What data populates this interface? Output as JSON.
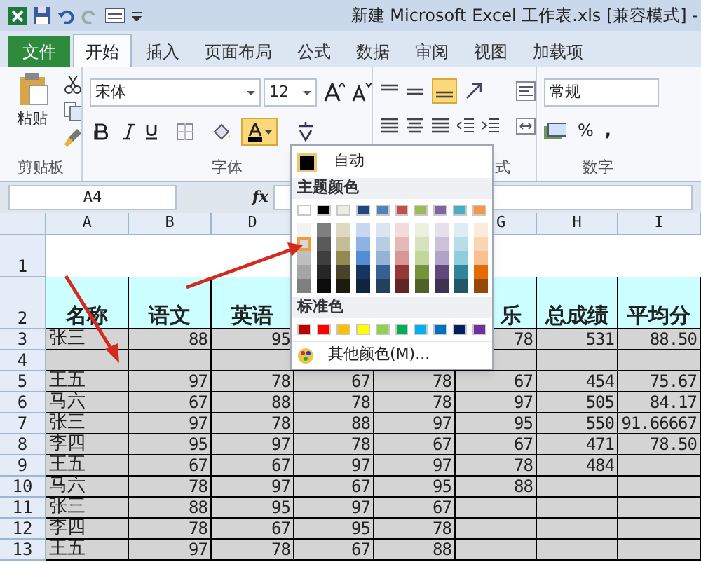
{
  "window": {
    "title": "新建 Microsoft Excel 工作表.xls  [兼容模式]  -"
  },
  "tabs": [
    {
      "label": "文件",
      "kind": "file",
      "selected": false
    },
    {
      "label": "开始",
      "kind": "tab",
      "selected": true
    },
    {
      "label": "插入",
      "kind": "tab",
      "selected": false
    },
    {
      "label": "页面布局",
      "kind": "tab",
      "selected": false
    },
    {
      "label": "公式",
      "kind": "tab",
      "selected": false
    },
    {
      "label": "数据",
      "kind": "tab",
      "selected": false
    },
    {
      "label": "审阅",
      "kind": "tab",
      "selected": false
    },
    {
      "label": "视图",
      "kind": "tab",
      "selected": false
    },
    {
      "label": "加载项",
      "kind": "tab",
      "selected": false
    }
  ],
  "ribbon": {
    "clipboard": {
      "paste_label": "粘贴",
      "group_label": "剪贴板"
    },
    "font": {
      "font_name": "宋体",
      "font_size": "12",
      "group_label": "字体",
      "font_color_open": true
    },
    "alignment": {
      "group_label": "式"
    },
    "number": {
      "format": "常规",
      "percent": "%",
      "comma": ",",
      "group_label": "数字"
    }
  },
  "formula_bar": {
    "name_box": "A4",
    "fx": "fx"
  },
  "color_menu": {
    "auto_label": "自动",
    "theme_label": "主题颜色",
    "theme_top": [
      {
        "color": "#ffffff"
      },
      {
        "color": "#000000"
      },
      {
        "color": "#eeece1"
      },
      {
        "color": "#1f497d"
      },
      {
        "color": "#4f81bd"
      },
      {
        "color": "#c0504d"
      },
      {
        "color": "#9bbb59"
      },
      {
        "color": "#8064a2"
      },
      {
        "color": "#4bacc6"
      },
      {
        "color": "#f79646"
      }
    ],
    "theme_shades": [
      [
        {
          "color": "#f2f2f2",
          "selected": false
        },
        {
          "color": "#7f7f7f",
          "selected": false
        },
        {
          "color": "#ddd9c3",
          "selected": false
        },
        {
          "color": "#c6d9f0",
          "selected": false
        },
        {
          "color": "#dbe5f1",
          "selected": false
        },
        {
          "color": "#f2dcdb",
          "selected": false
        },
        {
          "color": "#ebf1dd",
          "selected": false
        },
        {
          "color": "#e5e0ec",
          "selected": false
        },
        {
          "color": "#dbeef3",
          "selected": false
        },
        {
          "color": "#fdeada",
          "selected": false
        }
      ],
      [
        {
          "color": "#d8d8d8",
          "selected": true
        },
        {
          "color": "#595959",
          "selected": false
        },
        {
          "color": "#c4bd97",
          "selected": false
        },
        {
          "color": "#8db3e2",
          "selected": false
        },
        {
          "color": "#b8cce4",
          "selected": false
        },
        {
          "color": "#e5b9b7",
          "selected": false
        },
        {
          "color": "#d7e3bc",
          "selected": false
        },
        {
          "color": "#ccc1d9",
          "selected": false
        },
        {
          "color": "#b7dde8",
          "selected": false
        },
        {
          "color": "#fbd5b5",
          "selected": false
        }
      ],
      [
        {
          "color": "#bfbfbf",
          "selected": false
        },
        {
          "color": "#3f3f3f",
          "selected": false
        },
        {
          "color": "#938953",
          "selected": false
        },
        {
          "color": "#548dd4",
          "selected": false
        },
        {
          "color": "#95b3d7",
          "selected": false
        },
        {
          "color": "#d99694",
          "selected": false
        },
        {
          "color": "#c3d69b",
          "selected": false
        },
        {
          "color": "#b2a2c7",
          "selected": false
        },
        {
          "color": "#92cddc",
          "selected": false
        },
        {
          "color": "#fac08f",
          "selected": false
        }
      ],
      [
        {
          "color": "#a5a5a5",
          "selected": false
        },
        {
          "color": "#262626",
          "selected": false
        },
        {
          "color": "#494429",
          "selected": false
        },
        {
          "color": "#17365d",
          "selected": false
        },
        {
          "color": "#366092",
          "selected": false
        },
        {
          "color": "#953734",
          "selected": false
        },
        {
          "color": "#76923c",
          "selected": false
        },
        {
          "color": "#5f497a",
          "selected": false
        },
        {
          "color": "#31859b",
          "selected": false
        },
        {
          "color": "#e36c09",
          "selected": false
        }
      ],
      [
        {
          "color": "#7f7f7f",
          "selected": false
        },
        {
          "color": "#0c0c0c",
          "selected": false
        },
        {
          "color": "#1d1b10",
          "selected": false
        },
        {
          "color": "#0f243e",
          "selected": false
        },
        {
          "color": "#244061",
          "selected": false
        },
        {
          "color": "#632423",
          "selected": false
        },
        {
          "color": "#4f6128",
          "selected": false
        },
        {
          "color": "#3f3151",
          "selected": false
        },
        {
          "color": "#205867",
          "selected": false
        },
        {
          "color": "#974806",
          "selected": false
        }
      ]
    ],
    "standard_label": "标准色",
    "standard": [
      {
        "color": "#c00000"
      },
      {
        "color": "#ff0000"
      },
      {
        "color": "#ffc000"
      },
      {
        "color": "#ffff00"
      },
      {
        "color": "#92d050"
      },
      {
        "color": "#00b050"
      },
      {
        "color": "#00b0f0"
      },
      {
        "color": "#0070c0"
      },
      {
        "color": "#002060"
      },
      {
        "color": "#7030a0"
      }
    ],
    "more_label": "其他颜色(M)..."
  },
  "sheet": {
    "columns": [
      "A",
      "B",
      "D",
      null,
      null,
      "G",
      "H",
      "I"
    ],
    "rows": [
      {
        "number": "1",
        "kind": "blank",
        "cells": []
      },
      {
        "number": "2",
        "kind": "header",
        "cells": [
          "名称",
          "语文",
          "英语",
          null,
          null,
          "乐",
          "总成绩",
          "平均分"
        ]
      },
      {
        "number": "3",
        "kind": "data",
        "cells": [
          "张三",
          "88",
          "95",
          null,
          null,
          "78",
          "531",
          "88.50"
        ]
      },
      {
        "number": "4",
        "kind": "data",
        "cells": []
      },
      {
        "number": "5",
        "kind": "data",
        "cells": [
          "王五",
          "97",
          "78",
          "67",
          "78",
          "67",
          "454",
          "75.67"
        ]
      },
      {
        "number": "6",
        "kind": "data",
        "cells": [
          "马六",
          "67",
          "88",
          "78",
          "78",
          "97",
          "505",
          "84.17"
        ]
      },
      {
        "number": "7",
        "kind": "data",
        "cells": [
          "张三",
          "97",
          "78",
          "88",
          "97",
          "95",
          "550",
          "91.66667"
        ]
      },
      {
        "number": "8",
        "kind": "data",
        "cells": [
          "李四",
          "95",
          "97",
          "78",
          "67",
          "67",
          "471",
          "78.50"
        ]
      },
      {
        "number": "9",
        "kind": "data",
        "cells": [
          "王五",
          "67",
          "67",
          "97",
          "97",
          "78",
          "484",
          null
        ]
      },
      {
        "number": "10",
        "kind": "data",
        "cells": [
          "马六",
          "78",
          "97",
          "67",
          "95",
          "88",
          null,
          null
        ]
      },
      {
        "number": "11",
        "kind": "data",
        "cells": [
          "张三",
          "88",
          "95",
          "97",
          "67",
          null,
          null,
          null
        ]
      },
      {
        "number": "12",
        "kind": "data",
        "cells": [
          "李四",
          "78",
          "67",
          "95",
          "78",
          null,
          null,
          null
        ]
      },
      {
        "number": "13",
        "kind": "data",
        "cells": [
          "王五",
          "97",
          "78",
          "67",
          "88",
          null,
          null,
          null
        ]
      }
    ]
  }
}
